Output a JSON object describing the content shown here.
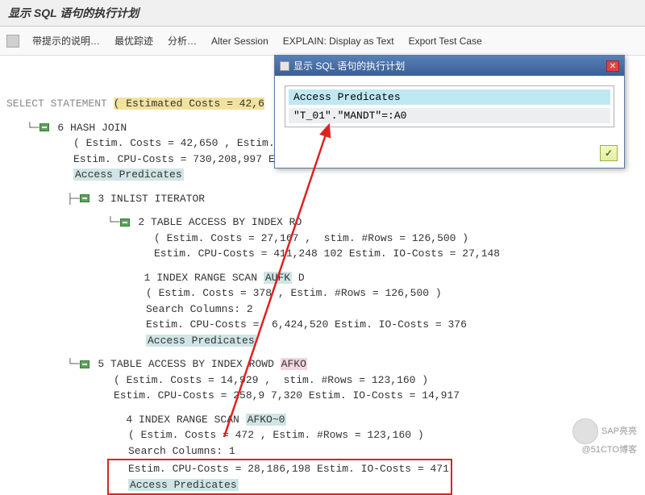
{
  "title": "显示 SQL 语句的执行计划",
  "toolbar": [
    "带提示的说明…",
    "最优踪迹",
    "分析…",
    "Alter Session",
    "EXPLAIN: Display as Text",
    "Export Test Case"
  ],
  "plan": {
    "root": "SELECT STATEMENT",
    "root_est": "( Estimated Costs = 42,6",
    "n6": "6 HASH JOIN",
    "n6_l1": "( Estim. Costs = 42,650 , Estim.",
    "n6_l2": "Estim. CPU-Costs = 730,208,997 E",
    "n6_l3": "Access Predicates",
    "n3": "3 INLIST ITERATOR",
    "n2": "2 TABLE ACCESS BY INDEX RO",
    "n2_l1_a": "( Estim. Costs = 27,167 , ",
    "n2_l1_b": "stim. #Rows = 126,500 )",
    "n2_l2_a": "Estim. CPU-Costs = 411,248",
    "n2_l2_b": "102 Estim. IO-Costs = 27,148",
    "n1": "1 INDEX RANGE SCAN ",
    "n1_h": "AUFK",
    "n1_h2": "D",
    "n1_l1_a": "( Estim. Costs = 378",
    "n1_l1_b": "  Estim. #Rows = 126,500 )",
    "n1_l2": "Search Columns: 2",
    "n1_l3_a": "Estim. CPU-Costs = ",
    "n1_l3_b": "6,424,520 Estim. IO-Costs = 376",
    "n1_l4": "Access Predicates",
    "n5": "5 TABLE ACCESS BY INDEX ROW",
    "n5_p": "AFKO",
    "n5_p1": "D ",
    "n5_l1": "( Estim. Costs = 14,929 , ",
    "n5_l1b": "stim. #Rows = 123,160 )",
    "n5_l2": "Estim. CPU-Costs = 258,9",
    "n5_l2b": "7,320 Estim. IO-Costs = 14,917",
    "n4": "4 INDEX RANGE SCAN ",
    "n4_h": "AFKO~0",
    "n4_l1": "( Estim. Costs = 472 , Estim. #Rows = 123,160 )",
    "n4_l2": "Search Columns: 1",
    "n4_l3": "Estim. CPU-Costs = 28,186,198 Estim. IO-Costs = 471",
    "n4_l4": "Access Predicates"
  },
  "popup": {
    "title": "显示 SQL 语句的执行计划",
    "head": "Access Predicates",
    "val": "\"T_01\".\"MANDT\"=:A0",
    "ok": "✓"
  },
  "watermark": {
    "top": "SAP亮亮",
    "bottom": "@51CTO博客"
  }
}
